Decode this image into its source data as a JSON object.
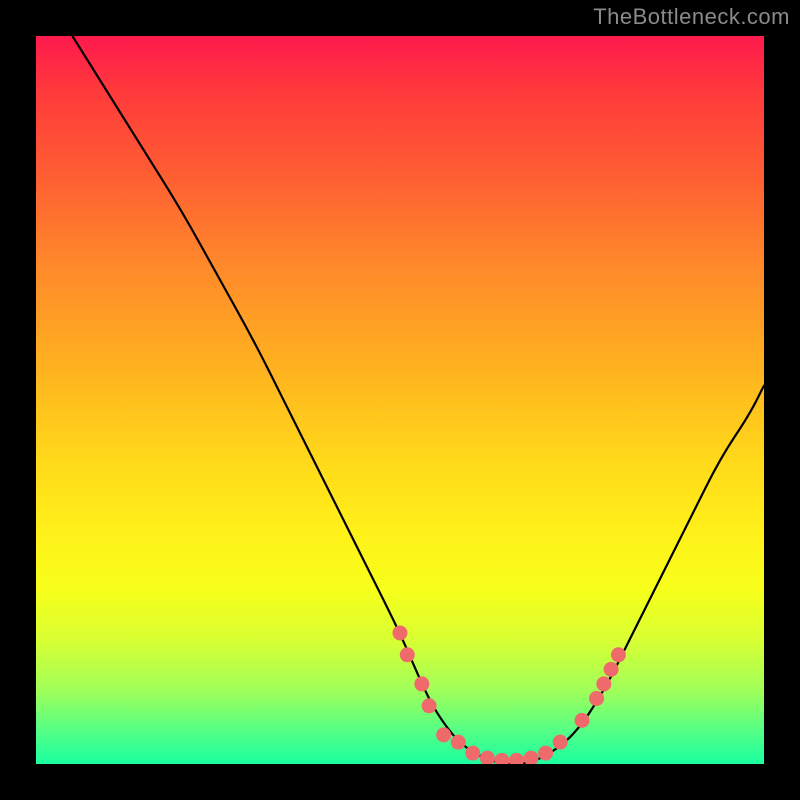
{
  "watermark": "TheBottleneck.com",
  "colors": {
    "background": "#000000",
    "curve": "#000000",
    "marker": "#ef6a6a",
    "gradient_top": "#ff1a4d",
    "gradient_bottom": "#1aff9f"
  },
  "chart_data": {
    "type": "line",
    "title": "",
    "xlabel": "",
    "ylabel": "",
    "xlim": [
      0,
      100
    ],
    "ylim": [
      0,
      100
    ],
    "series": [
      {
        "name": "curve",
        "x": [
          5,
          10,
          15,
          20,
          25,
          30,
          34,
          38,
          42,
          46,
          50,
          53,
          55,
          58,
          61,
          64,
          67,
          70,
          74,
          78,
          82,
          86,
          90,
          94,
          98,
          100
        ],
        "values": [
          100,
          92,
          84,
          76,
          67,
          58,
          50,
          42,
          34,
          26,
          18,
          11,
          7,
          3,
          1,
          0,
          0,
          1,
          4,
          10,
          18,
          26,
          34,
          42,
          48,
          52
        ]
      }
    ],
    "markers": [
      {
        "x": 50,
        "y": 18
      },
      {
        "x": 51,
        "y": 15
      },
      {
        "x": 53,
        "y": 11
      },
      {
        "x": 54,
        "y": 8
      },
      {
        "x": 56,
        "y": 4
      },
      {
        "x": 58,
        "y": 3
      },
      {
        "x": 60,
        "y": 1.5
      },
      {
        "x": 62,
        "y": 0.8
      },
      {
        "x": 64,
        "y": 0.5
      },
      {
        "x": 66,
        "y": 0.5
      },
      {
        "x": 68,
        "y": 0.8
      },
      {
        "x": 70,
        "y": 1.5
      },
      {
        "x": 72,
        "y": 3
      },
      {
        "x": 75,
        "y": 6
      },
      {
        "x": 77,
        "y": 9
      },
      {
        "x": 78,
        "y": 11
      },
      {
        "x": 79,
        "y": 13
      },
      {
        "x": 80,
        "y": 15
      }
    ]
  }
}
